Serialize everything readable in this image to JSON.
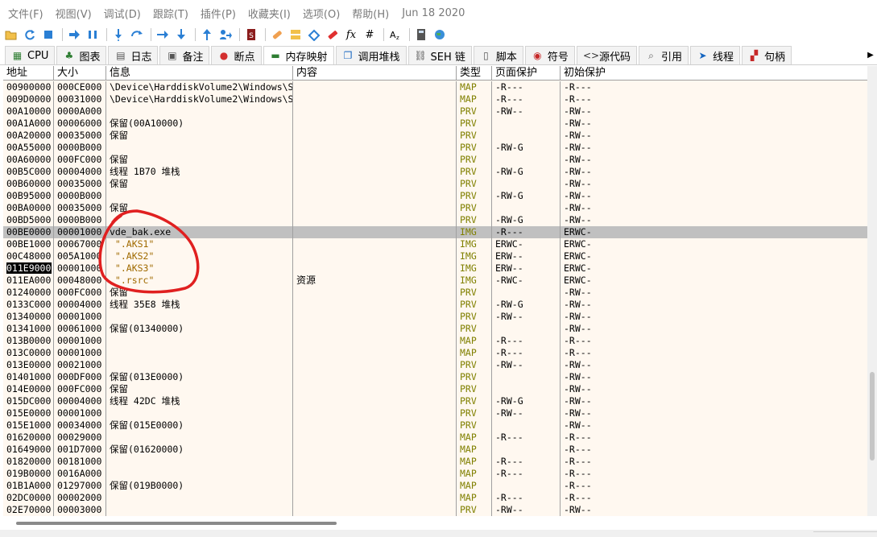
{
  "menu": [
    "文件(F)",
    "视图(V)",
    "调试(D)",
    "跟踪(T)",
    "插件(P)",
    "收藏夹(I)",
    "选项(O)",
    "帮助(H)"
  ],
  "menu_date": "Jun 18 2020",
  "toolbar": {
    "icons": [
      "open-icon",
      "restart-icon",
      "stop-icon",
      "run-icon",
      "pause-icon",
      "step-into-icon",
      "step-over-icon",
      "trace-into-icon",
      "trace-over-icon",
      "execute-till-return-icon",
      "run-to-user-code-icon",
      "script-icon",
      "patch-icon",
      "comment-icon",
      "label-icon",
      "bookmark-icon",
      "function-icon",
      "hash-icon",
      "font-icon",
      "calculator-icon",
      "globe-icon"
    ],
    "fx_label": "fx",
    "hash_label": "#"
  },
  "tabs": [
    {
      "label": "CPU",
      "icon": "cpu-icon"
    },
    {
      "label": "图表",
      "icon": "graph-icon"
    },
    {
      "label": "日志",
      "icon": "log-icon"
    },
    {
      "label": "备注",
      "icon": "notes-icon"
    },
    {
      "label": "断点",
      "icon": "breakpoint-icon"
    },
    {
      "label": "内存映射",
      "icon": "memory-map-icon"
    },
    {
      "label": "调用堆栈",
      "icon": "call-stack-icon"
    },
    {
      "label": "SEH 链",
      "icon": "seh-icon"
    },
    {
      "label": "脚本",
      "icon": "script-tab-icon"
    },
    {
      "label": "符号",
      "icon": "symbols-icon"
    },
    {
      "label": "源代码",
      "icon": "source-icon"
    },
    {
      "label": "引用",
      "icon": "references-icon"
    },
    {
      "label": "线程",
      "icon": "threads-icon"
    },
    {
      "label": "句柄",
      "icon": "handles-icon"
    }
  ],
  "active_tab": "内存映射",
  "columns": [
    "地址",
    "大小",
    "信息",
    "内容",
    "类型",
    "页面保护",
    "初始保护"
  ],
  "rows": [
    {
      "addr": "00900000",
      "size": "000CE000",
      "info": "\\Device\\HarddiskVolume2\\Windows\\S",
      "content": "",
      "type": "MAP",
      "page": "-R---",
      "init": "-R---"
    },
    {
      "addr": "009D0000",
      "size": "00031000",
      "info": "\\Device\\HarddiskVolume2\\Windows\\S",
      "content": "",
      "type": "MAP",
      "page": "-R---",
      "init": "-R---"
    },
    {
      "addr": "00A10000",
      "size": "0000A000",
      "info": "",
      "content": "",
      "type": "PRV",
      "page": "-RW--",
      "init": "-RW--"
    },
    {
      "addr": "00A1A000",
      "size": "00006000",
      "info": "保留(00A10000)",
      "content": "",
      "type": "PRV",
      "page": "",
      "init": "-RW--"
    },
    {
      "addr": "00A20000",
      "size": "00035000",
      "info": "保留",
      "content": "",
      "type": "PRV",
      "page": "",
      "init": "-RW--"
    },
    {
      "addr": "00A55000",
      "size": "0000B000",
      "info": "",
      "content": "",
      "type": "PRV",
      "page": "-RW-G",
      "init": "-RW--"
    },
    {
      "addr": "00A60000",
      "size": "000FC000",
      "info": "保留",
      "content": "",
      "type": "PRV",
      "page": "",
      "init": "-RW--"
    },
    {
      "addr": "00B5C000",
      "size": "00004000",
      "info": "线程 1B70 堆栈",
      "content": "",
      "type": "PRV",
      "page": "-RW-G",
      "init": "-RW--"
    },
    {
      "addr": "00B60000",
      "size": "00035000",
      "info": "保留",
      "content": "",
      "type": "PRV",
      "page": "",
      "init": "-RW--"
    },
    {
      "addr": "00B95000",
      "size": "0000B000",
      "info": "",
      "content": "",
      "type": "PRV",
      "page": "-RW-G",
      "init": "-RW--"
    },
    {
      "addr": "00BA0000",
      "size": "00035000",
      "info": "保留",
      "content": "",
      "type": "PRV",
      "page": "",
      "init": "-RW--"
    },
    {
      "addr": "00BD5000",
      "size": "0000B000",
      "info": "",
      "content": "",
      "type": "PRV",
      "page": "-RW-G",
      "init": "-RW--"
    },
    {
      "addr": "00BE0000",
      "size": "00001000",
      "info": "vde_bak.exe",
      "content": "",
      "type": "IMG",
      "page": "-R---",
      "init": "ERWC-",
      "selected": true
    },
    {
      "addr": "00BE1000",
      "size": "00067000",
      "info": " \".AKS1\"",
      "content": "",
      "type": "IMG",
      "page": "ERWC-",
      "init": "ERWC-",
      "section": true
    },
    {
      "addr": "00C48000",
      "size": "005A1000",
      "info": " \".AKS2\"",
      "content": "",
      "type": "IMG",
      "page": "ERW--",
      "init": "ERWC-",
      "section": true
    },
    {
      "addr": "011E9000",
      "size": "00001000",
      "info": " \".AKS3\"",
      "content": "",
      "type": "IMG",
      "page": "ERW--",
      "init": "ERWC-",
      "section": true,
      "addr_highlight": true
    },
    {
      "addr": "011EA000",
      "size": "00048000",
      "info": " \".rsrc\"",
      "content": "资源",
      "type": "IMG",
      "page": "-RWC-",
      "init": "ERWC-",
      "section": true
    },
    {
      "addr": "01240000",
      "size": "000FC000",
      "info": "保留",
      "content": "",
      "type": "PRV",
      "page": "",
      "init": "-RW--"
    },
    {
      "addr": "0133C000",
      "size": "00004000",
      "info": "线程 35E8 堆栈",
      "content": "",
      "type": "PRV",
      "page": "-RW-G",
      "init": "-RW--"
    },
    {
      "addr": "01340000",
      "size": "00001000",
      "info": "",
      "content": "",
      "type": "PRV",
      "page": "-RW--",
      "init": "-RW--"
    },
    {
      "addr": "01341000",
      "size": "00061000",
      "info": "保留(01340000)",
      "content": "",
      "type": "PRV",
      "page": "",
      "init": "-RW--"
    },
    {
      "addr": "013B0000",
      "size": "00001000",
      "info": "",
      "content": "",
      "type": "MAP",
      "page": "-R---",
      "init": "-R---"
    },
    {
      "addr": "013C0000",
      "size": "00001000",
      "info": "",
      "content": "",
      "type": "MAP",
      "page": "-R---",
      "init": "-R---"
    },
    {
      "addr": "013E0000",
      "size": "00021000",
      "info": "",
      "content": "",
      "type": "PRV",
      "page": "-RW--",
      "init": "-RW--"
    },
    {
      "addr": "01401000",
      "size": "000DF000",
      "info": "保留(013E0000)",
      "content": "",
      "type": "PRV",
      "page": "",
      "init": "-RW--"
    },
    {
      "addr": "014E0000",
      "size": "000FC000",
      "info": "保留",
      "content": "",
      "type": "PRV",
      "page": "",
      "init": "-RW--"
    },
    {
      "addr": "015DC000",
      "size": "00004000",
      "info": "线程 42DC 堆栈",
      "content": "",
      "type": "PRV",
      "page": "-RW-G",
      "init": "-RW--"
    },
    {
      "addr": "015E0000",
      "size": "00001000",
      "info": "",
      "content": "",
      "type": "PRV",
      "page": "-RW--",
      "init": "-RW--"
    },
    {
      "addr": "015E1000",
      "size": "00034000",
      "info": "保留(015E0000)",
      "content": "",
      "type": "PRV",
      "page": "",
      "init": "-RW--"
    },
    {
      "addr": "01620000",
      "size": "00029000",
      "info": "",
      "content": "",
      "type": "MAP",
      "page": "-R---",
      "init": "-R---"
    },
    {
      "addr": "01649000",
      "size": "001D7000",
      "info": "保留(01620000)",
      "content": "",
      "type": "MAP",
      "page": "",
      "init": "-R---"
    },
    {
      "addr": "01820000",
      "size": "00181000",
      "info": "",
      "content": "",
      "type": "MAP",
      "page": "-R---",
      "init": "-R---"
    },
    {
      "addr": "019B0000",
      "size": "0016A000",
      "info": "",
      "content": "",
      "type": "MAP",
      "page": "-R---",
      "init": "-R---"
    },
    {
      "addr": "01B1A000",
      "size": "01297000",
      "info": "保留(019B0000)",
      "content": "",
      "type": "MAP",
      "page": "",
      "init": "-R---"
    },
    {
      "addr": "02DC0000",
      "size": "00002000",
      "info": "",
      "content": "",
      "type": "MAP",
      "page": "-R---",
      "init": "-R---"
    },
    {
      "addr": "02E70000",
      "size": "00003000",
      "info": "",
      "content": "",
      "type": "PRV",
      "page": "-RW--",
      "init": "-RW--"
    }
  ],
  "colors": {
    "table_bg": "#fff8f0",
    "type_text": "#808000",
    "section_text": "#a06a00",
    "selected_row": "#c0c0c0",
    "annotation": "#e02020"
  }
}
